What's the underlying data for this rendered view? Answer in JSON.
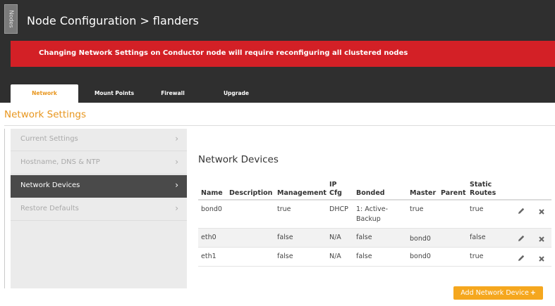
{
  "side_tab": "Nodes",
  "header": {
    "title": "Node Configuration > flanders",
    "alert": "Changing Network Settings on Conductor node will require reconfiguring all clustered nodes"
  },
  "tabs": [
    {
      "label": "Network",
      "active": true
    },
    {
      "label": "Mount Points",
      "active": false
    },
    {
      "label": "Firewall",
      "active": false
    },
    {
      "label": "Upgrade",
      "active": false
    }
  ],
  "section_title": "Network Settings",
  "sidebar": {
    "items": [
      {
        "label": "Current Settings",
        "active": false
      },
      {
        "label": "Hostname, DNS & NTP",
        "active": false
      },
      {
        "label": "Network Devices",
        "active": true
      },
      {
        "label": "Restore Defaults",
        "active": false
      }
    ]
  },
  "main": {
    "title": "Network Devices",
    "columns": {
      "name": "Name",
      "description": "Description",
      "management": "Management",
      "ip_cfg_1": "IP",
      "ip_cfg_2": "Cfg",
      "bonded": "Bonded",
      "master": "Master",
      "parent": "Parent",
      "static_routes_1": "Static",
      "static_routes_2": "Routes"
    },
    "rows": [
      {
        "name": "bond0",
        "description": "",
        "management": "true",
        "ip_cfg": "DHCP",
        "bonded_1": "1: Active-",
        "bonded_2": "Backup",
        "master": "true",
        "parent": "",
        "static_routes": "true"
      },
      {
        "name": "eth0",
        "description": "",
        "management": "false",
        "ip_cfg": "N/A",
        "bonded_1": "false",
        "bonded_2": "",
        "master": "bond0",
        "parent": "",
        "static_routes": "false"
      },
      {
        "name": "eth1",
        "description": "",
        "management": "false",
        "ip_cfg": "N/A",
        "bonded_1": "false",
        "bonded_2": "",
        "master": "bond0",
        "parent": "",
        "static_routes": "true"
      }
    ],
    "add_button": "Add Network Device",
    "add_button_icon": "+"
  },
  "colors": {
    "accent": "#e8961e",
    "alert": "#d32026",
    "header_bg": "#2f2f2f",
    "button": "#f5a71e"
  },
  "icons": [
    "pencil-icon",
    "close-icon",
    "chevron-right-icon"
  ]
}
